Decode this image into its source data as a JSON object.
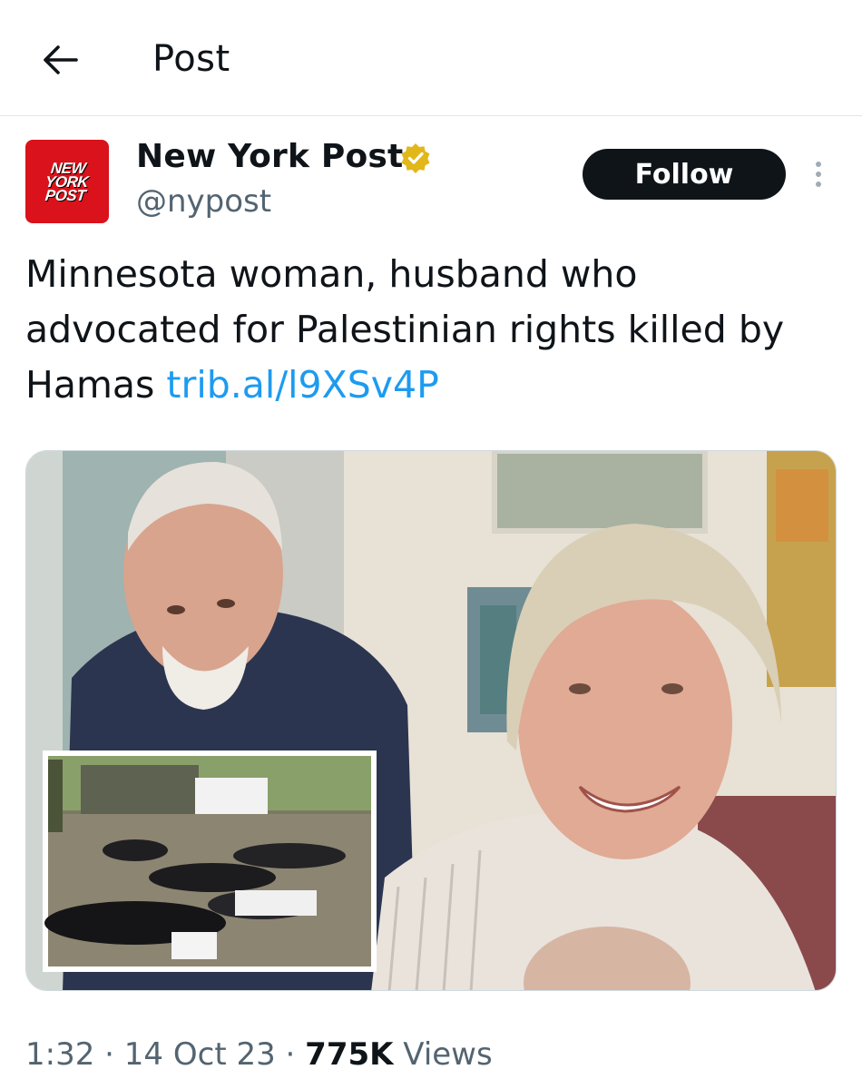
{
  "header": {
    "title": "Post"
  },
  "author": {
    "logo_lines": [
      "NEW",
      "YORK",
      "POST"
    ],
    "name": "New York Post",
    "handle": "@nypost",
    "follow_label": "Follow"
  },
  "tweet": {
    "text": "Minnesota woman, husband who advocated for Palestinian rights killed by Hamas ",
    "link": "trib.al/l9XSv4P"
  },
  "meta": {
    "time": "1:32",
    "sep1": " · ",
    "date": "14 Oct 23",
    "sep2": " · ",
    "views_count": "775K",
    "views_label": " Views"
  },
  "colors": {
    "brand_red": "#d9121b",
    "link": "#1d9bf0",
    "verified_gold": "#e2b719",
    "follow_bg": "#0f1419"
  },
  "icons": {
    "back": "arrow-left-icon",
    "verified": "verified-badge-icon",
    "more": "more-vertical-icon"
  }
}
